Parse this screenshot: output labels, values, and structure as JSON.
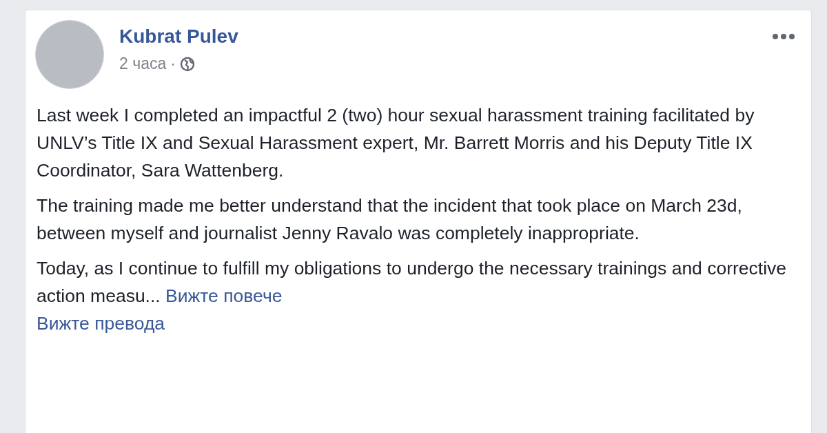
{
  "post": {
    "author": "Kubrat Pulev",
    "time": "2 часа",
    "separator": "·",
    "paragraphs": [
      "Last week I completed an impactful 2 (two) hour sexual harassment training facilitated by UNLV’s Title IX and Sexual Harassment expert, Mr. Barrett Morris and his Deputy Title IX Coordinator, Sara Wattenberg.",
      "The training made me better understand that the incident that took place on March 23d, between myself and journalist Jenny Ravalo was completely inappropriate.",
      "Today, as I continue to fulfill my obligations to undergo the necessary trainings and corrective action measu..."
    ],
    "see_more": "Вижте повече",
    "see_translation": "Вижте превода"
  }
}
